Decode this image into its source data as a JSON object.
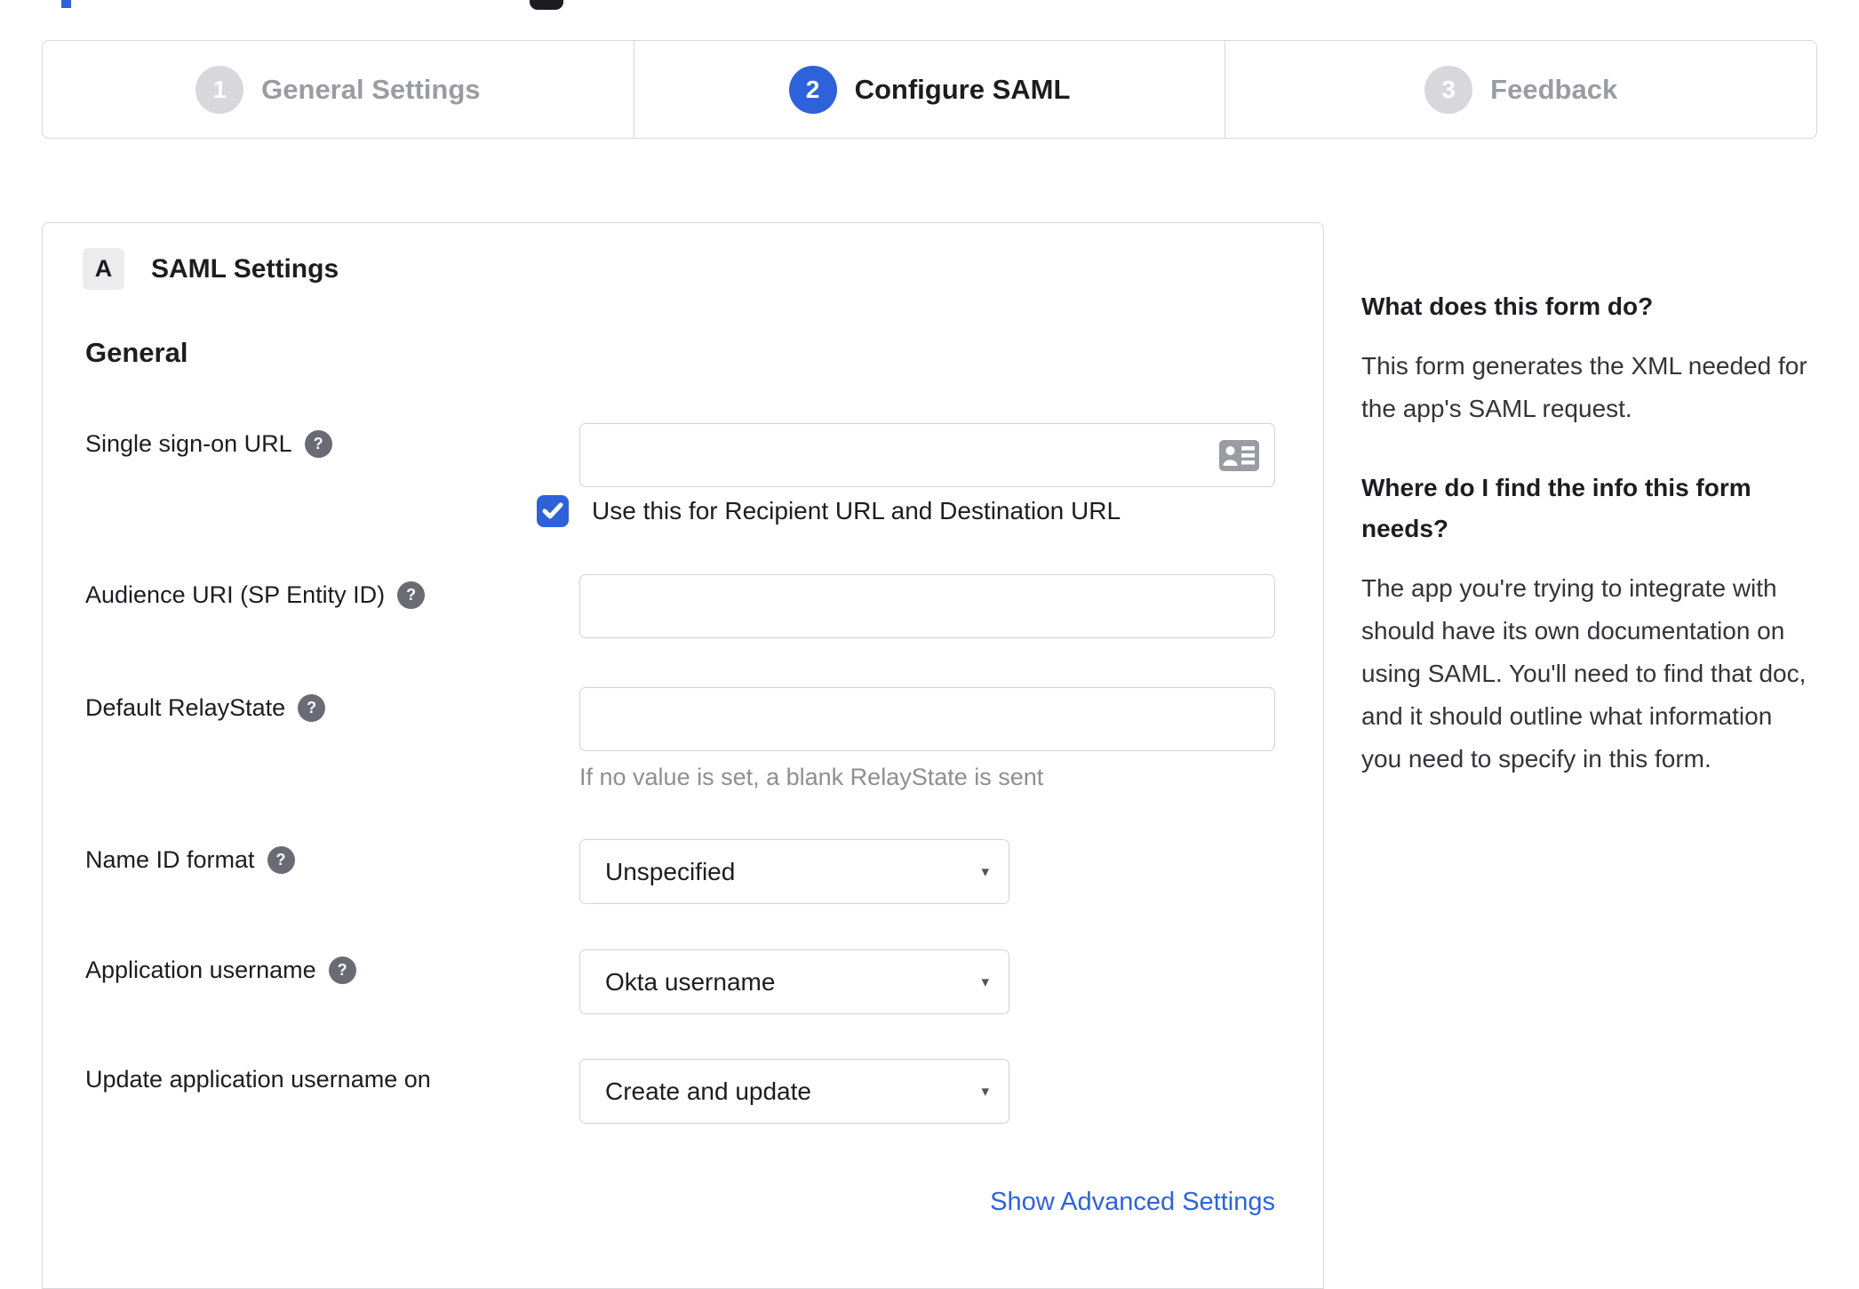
{
  "stepper": {
    "steps": [
      {
        "number": "1",
        "label": "General Settings",
        "state": "inactive"
      },
      {
        "number": "2",
        "label": "Configure SAML",
        "state": "active"
      },
      {
        "number": "3",
        "label": "Feedback",
        "state": "inactive"
      }
    ]
  },
  "panel": {
    "badge": "A",
    "title": "SAML Settings",
    "section_heading": "General",
    "fields": [
      {
        "label": "Single sign-on URL",
        "type": "text",
        "value": ""
      },
      {
        "label": "Audience URI (SP Entity ID)",
        "type": "text",
        "value": ""
      },
      {
        "label": "Default RelayState",
        "type": "text",
        "value": "",
        "note": "If no value is set, a blank RelayState is sent"
      },
      {
        "label": "Name ID format",
        "type": "select",
        "value": "Unspecified"
      },
      {
        "label": "Application username",
        "type": "select",
        "value": "Okta username"
      },
      {
        "label": "Update application username on",
        "type": "select",
        "value": "Create and update"
      }
    ],
    "checkbox": {
      "checked": true,
      "label": "Use this for Recipient URL and Destination URL"
    },
    "advanced_link": "Show Advanced Settings"
  },
  "sidebar": {
    "heading1": "What does this form do?",
    "para1": "This form generates the XML needed for the app's SAML request.",
    "heading2": "Where do I find the info this form needs?",
    "para2": "The app you're trying to integrate with should have its own documentation on using SAML. You'll need to find that doc, and it should outline what information you need to specify in this form."
  },
  "icons": {
    "help": "?",
    "caret": "▾"
  },
  "colors": {
    "accent_blue": "#2e62d9",
    "border_gray": "#d7d7dc",
    "inactive_gray": "#9b9ba3",
    "text_dark": "#1d1d21",
    "muted_text": "#8e8e93"
  }
}
